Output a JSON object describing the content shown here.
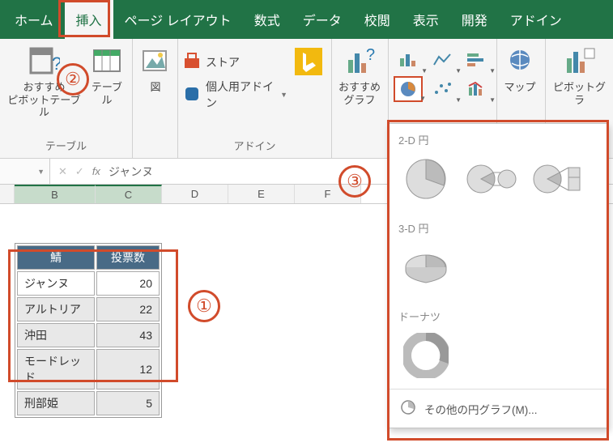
{
  "tabs": {
    "home": "ホーム",
    "insert": "挿入",
    "page_layout": "ページ レイアウト",
    "formulas": "数式",
    "data": "データ",
    "review": "校閲",
    "view": "表示",
    "developer": "開発",
    "addins": "アドイン"
  },
  "ribbon": {
    "pivot_rec": "おすすめ\nピボットテーブル",
    "table": "テーブル",
    "group_tables": "テーブル",
    "illustrations": "図",
    "store": "ストア",
    "my_addins": "個人用アドイン",
    "group_addins": "アドイン",
    "rec_charts": "おすすめ\nグラフ",
    "maps": "マップ",
    "pivot_chart": "ピボットグラ"
  },
  "formula_bar": {
    "fx": "fx",
    "value": "ジャンヌ"
  },
  "columns": {
    "B": "B",
    "C": "C",
    "D": "D",
    "E": "E",
    "F": "F"
  },
  "table": {
    "h1": "鯖",
    "h2": "投票数",
    "rows": [
      {
        "name": "ジャンヌ",
        "val": "20"
      },
      {
        "name": "アルトリア",
        "val": "22"
      },
      {
        "name": "沖田",
        "val": "43"
      },
      {
        "name": "モードレッド",
        "val": "12"
      },
      {
        "name": "刑部姫",
        "val": "5"
      }
    ]
  },
  "pie_panel": {
    "sec_2d": "2-D 円",
    "sec_3d": "3-D 円",
    "sec_donut": "ドーナツ",
    "more": "その他の円グラフ(M)..."
  },
  "annotations": {
    "one": "①",
    "two": "②",
    "three": "③"
  },
  "chart_data": {
    "type": "pie",
    "title": "",
    "categories": [
      "ジャンヌ",
      "アルトリア",
      "沖田",
      "モードレッド",
      "刑部姫"
    ],
    "values": [
      20,
      22,
      43,
      12,
      5
    ]
  }
}
